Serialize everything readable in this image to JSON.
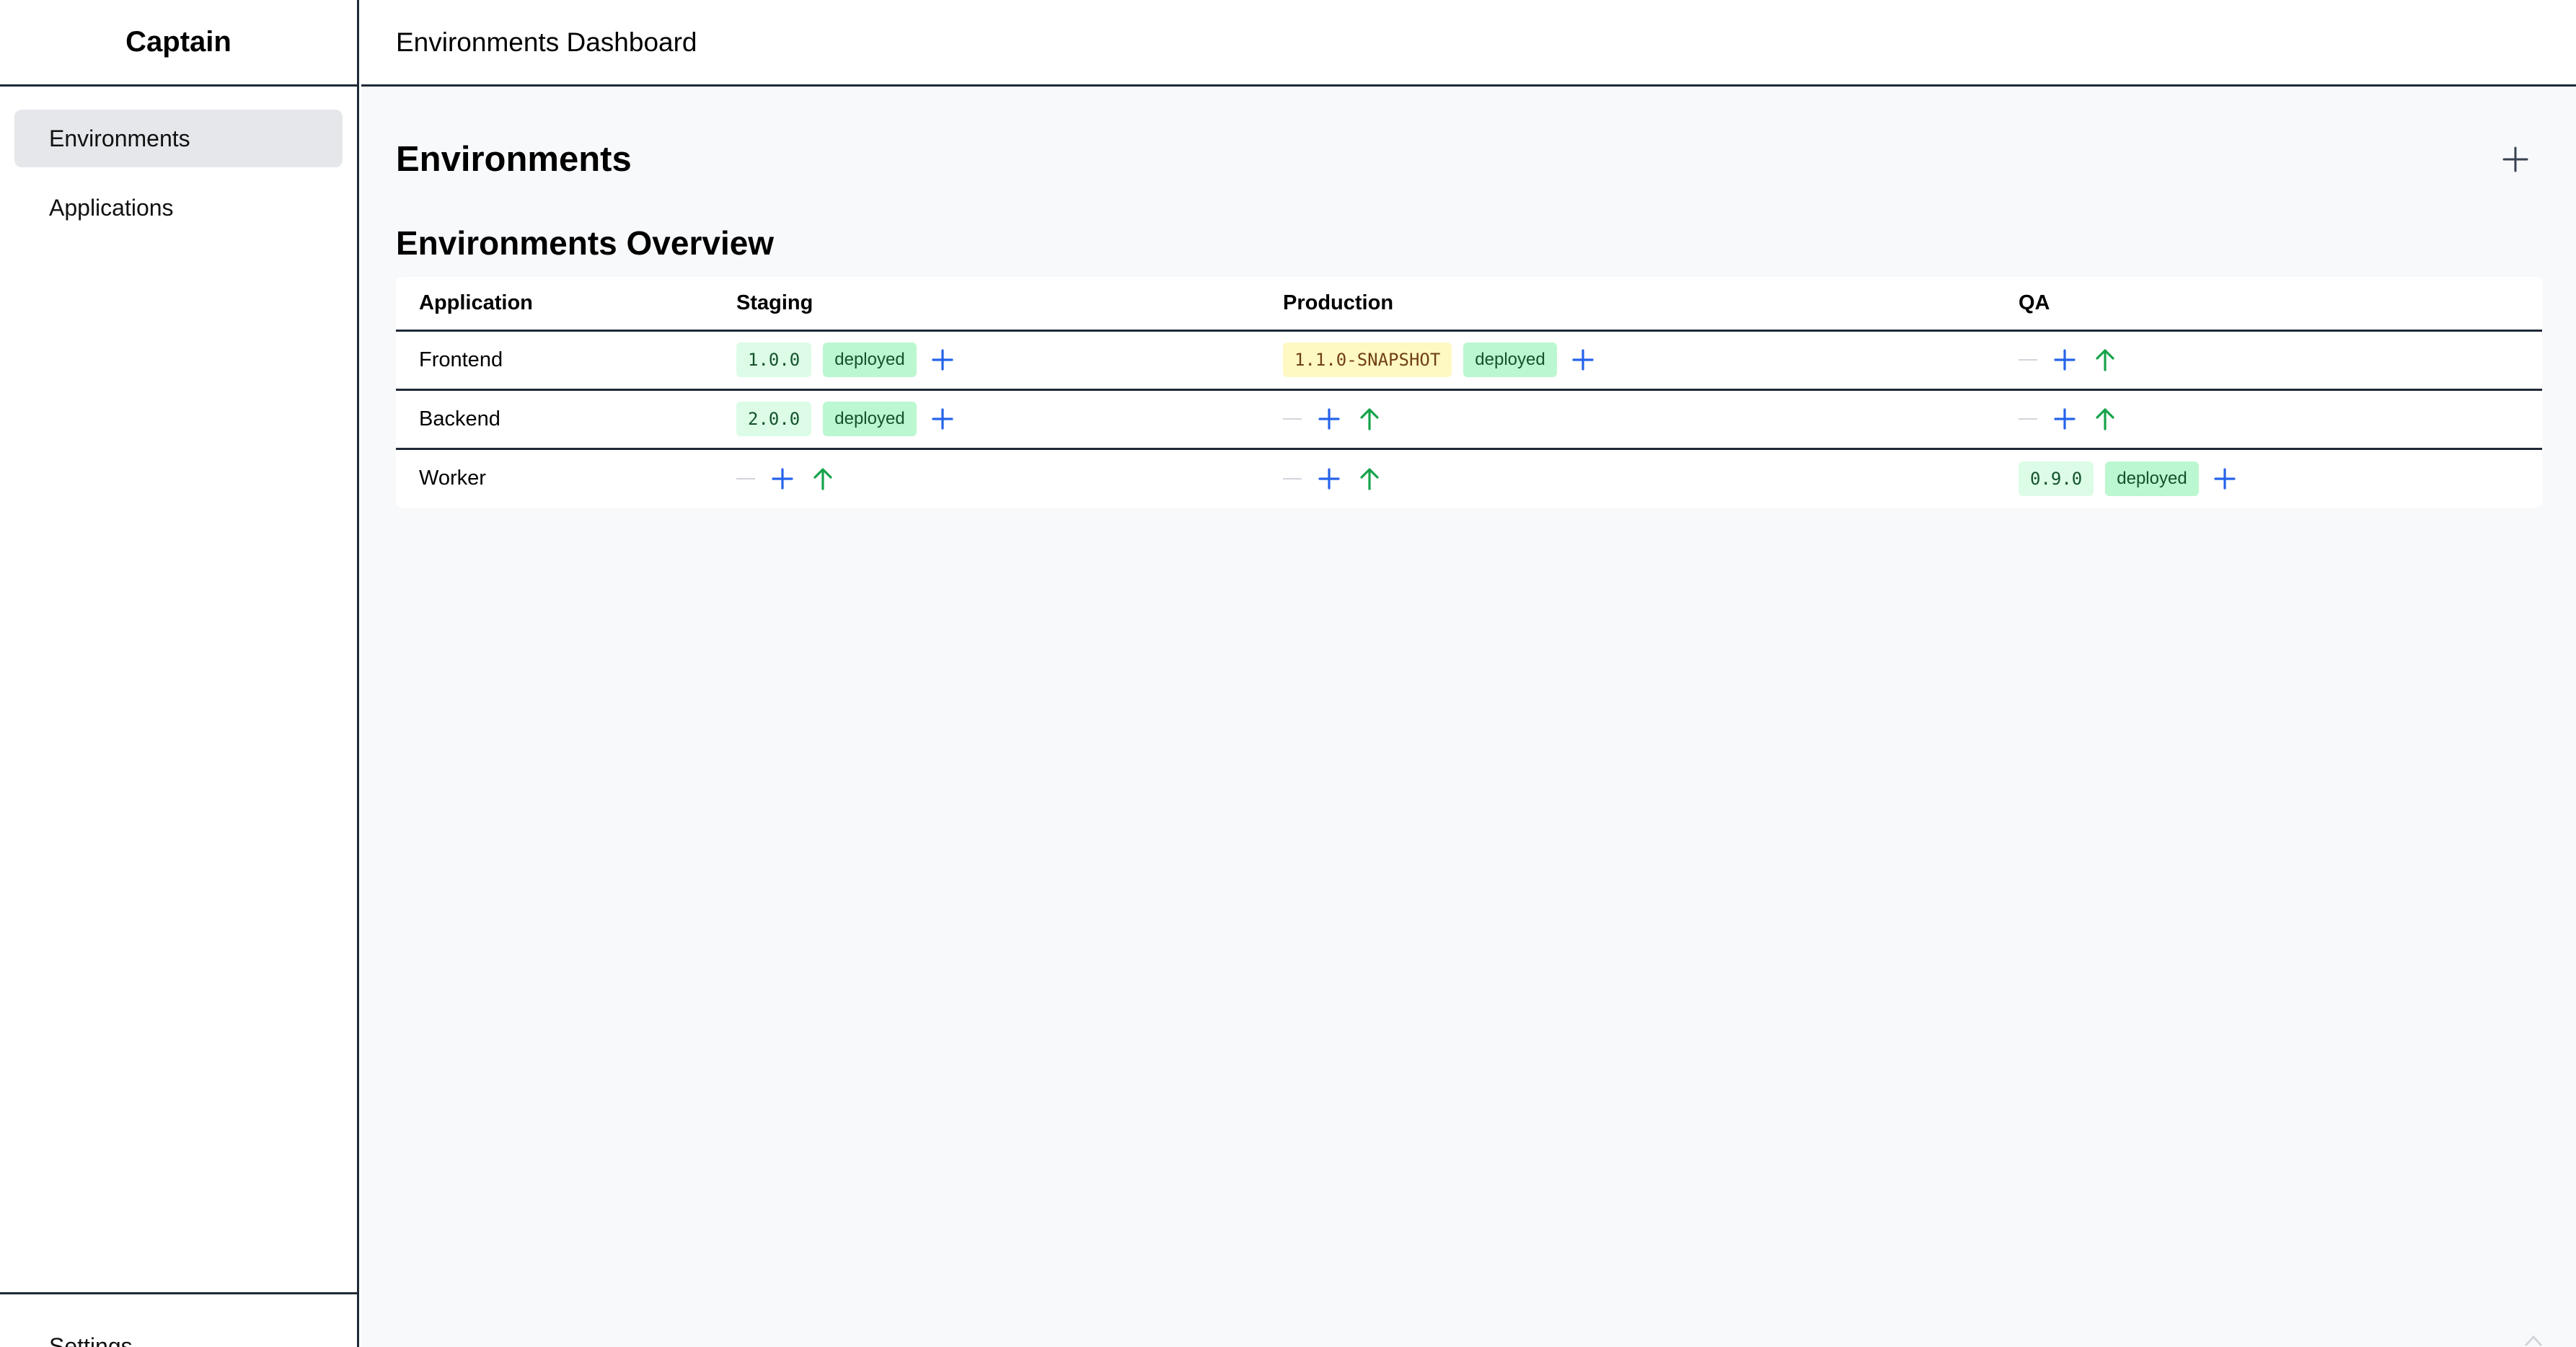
{
  "app": {
    "brand": "Captain",
    "header_title": "Environments Dashboard"
  },
  "sidebar": {
    "items": [
      {
        "label": "Environments",
        "active": true
      },
      {
        "label": "Applications",
        "active": false
      }
    ],
    "footer_label": "Settings"
  },
  "main": {
    "page_title": "Environments",
    "add_icon": "plus-icon",
    "section_title": "Environments Overview",
    "table": {
      "columns": [
        "Application",
        "Staging",
        "Production",
        "QA"
      ],
      "rows": [
        {
          "application": "Frontend",
          "staging": {
            "version": "1.0.0",
            "status": "deployed"
          },
          "production": {
            "version": "1.1.0-SNAPSHOT",
            "status": "deployed",
            "snapshot": true
          },
          "qa": null
        },
        {
          "application": "Backend",
          "staging": {
            "version": "2.0.0",
            "status": "deployed"
          },
          "production": null,
          "qa": null
        },
        {
          "application": "Worker",
          "staging": null,
          "production": null,
          "qa": {
            "version": "0.9.0",
            "status": "deployed"
          }
        }
      ],
      "empty_marker": "—"
    }
  },
  "colors": {
    "accent_blue": "#2563eb",
    "promote_green": "#16a34a",
    "deployed_bg": "#bbf7d0",
    "version_bg": "#dcfce7",
    "snapshot_bg": "#fef9c3",
    "border": "#1f2937"
  }
}
